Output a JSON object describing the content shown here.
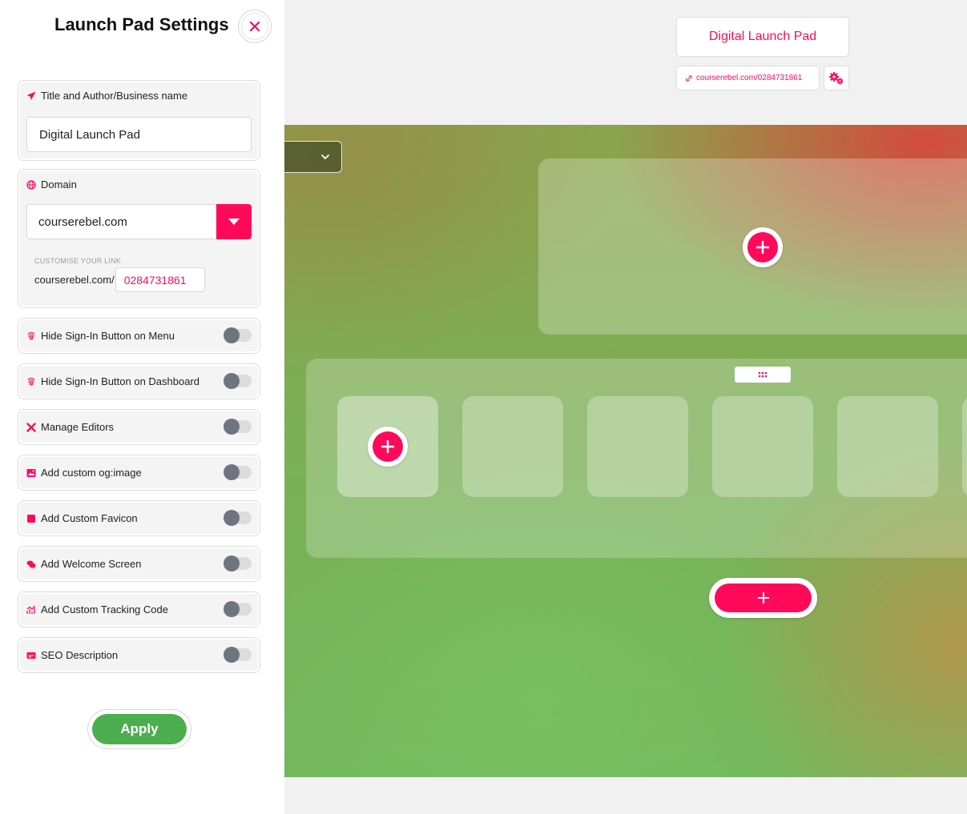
{
  "sidebar": {
    "title": "Launch Pad Settings",
    "title_author": {
      "label": "Title and Author/Business name",
      "value": "Digital Launch Pad"
    },
    "domain": {
      "label": "Domain",
      "selected": "courserebel.com",
      "customise_hint": "CUSTOMISE YOUR LINK",
      "prefix": "courserebel.com/",
      "slug": "0284731861"
    },
    "options": [
      {
        "label": "Hide Sign-In Button on Menu",
        "icon": "fingerprint-icon",
        "enabled": false
      },
      {
        "label": "Hide Sign-In Button on Dashboard",
        "icon": "fingerprint-icon",
        "enabled": false
      },
      {
        "label": "Manage Editors",
        "icon": "tools-icon",
        "enabled": false
      },
      {
        "label": "Add custom og:image",
        "icon": "image-icon",
        "enabled": false
      },
      {
        "label": "Add Custom Favicon",
        "icon": "square-icon",
        "enabled": false
      },
      {
        "label": "Add Welcome Screen",
        "icon": "chat-icon",
        "enabled": false
      },
      {
        "label": "Add Custom Tracking Code",
        "icon": "chart-icon",
        "enabled": false
      },
      {
        "label": "SEO Description",
        "icon": "card-icon",
        "enabled": false
      }
    ],
    "apply_label": "Apply"
  },
  "header": {
    "title": "Digital Launch Pad",
    "link": "courserebel.com/0284731861"
  },
  "colors": {
    "accent": "#ff0a5a",
    "apply_green": "#4cae4f"
  }
}
